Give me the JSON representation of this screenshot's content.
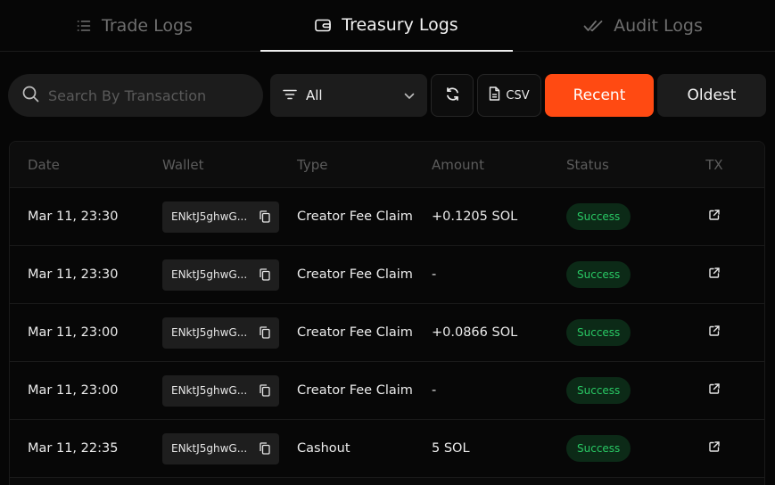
{
  "tabs": [
    {
      "label": "Trade Logs",
      "icon": "list-icon",
      "active": false
    },
    {
      "label": "Treasury Logs",
      "icon": "wallet-icon",
      "active": true
    },
    {
      "label": "Audit Logs",
      "icon": "double-check-icon",
      "active": false
    }
  ],
  "toolbar": {
    "search_placeholder": "Search By Transaction",
    "filter_value": "All",
    "csv_label": "CSV",
    "recent_label": "Recent",
    "oldest_label": "Oldest"
  },
  "colors": {
    "accent": "#ff4a12",
    "success_text": "#29c864",
    "success_bg": "#0c2a17"
  },
  "table": {
    "headers": [
      "Date",
      "Wallet",
      "Type",
      "Amount",
      "Status",
      "TX"
    ],
    "rows": [
      {
        "date": "Mar 11, 23:30",
        "wallet": "ENktJ5ghwG...",
        "type": "Creator Fee Claim",
        "amount": "+0.1205 SOL",
        "status": "Success"
      },
      {
        "date": "Mar 11, 23:30",
        "wallet": "ENktJ5ghwG...",
        "type": "Creator Fee Claim",
        "amount": "-",
        "status": "Success"
      },
      {
        "date": "Mar 11, 23:00",
        "wallet": "ENktJ5ghwG...",
        "type": "Creator Fee Claim",
        "amount": "+0.0866 SOL",
        "status": "Success"
      },
      {
        "date": "Mar 11, 23:00",
        "wallet": "ENktJ5ghwG...",
        "type": "Creator Fee Claim",
        "amount": "-",
        "status": "Success"
      },
      {
        "date": "Mar 11, 22:35",
        "wallet": "ENktJ5ghwG...",
        "type": "Cashout",
        "amount": "5 SOL",
        "status": "Success"
      }
    ]
  }
}
